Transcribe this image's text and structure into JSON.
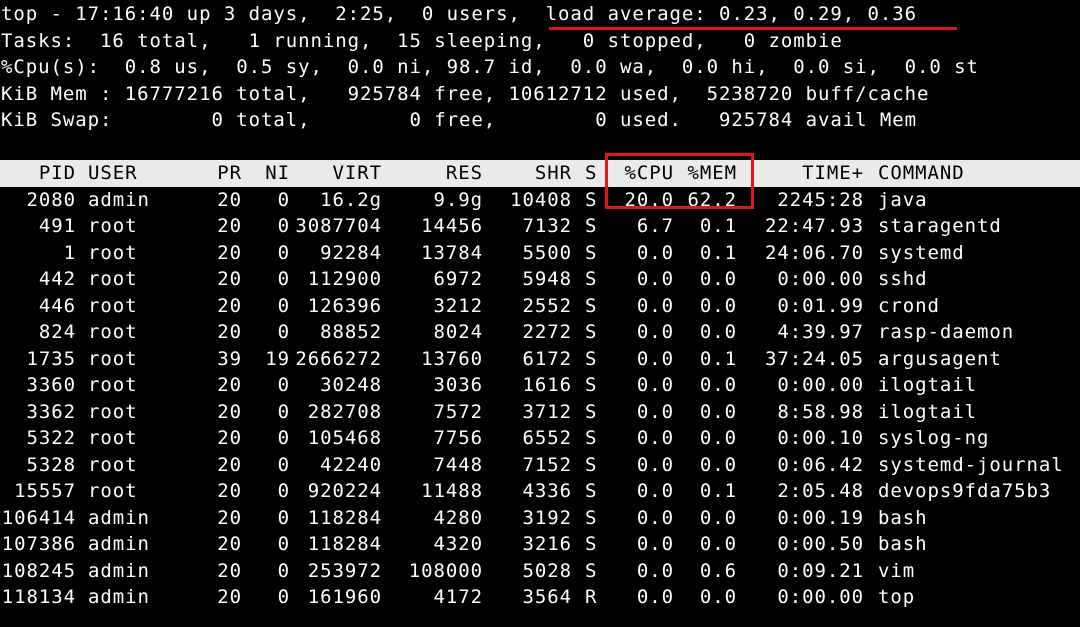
{
  "summary": [
    "top - 17:16:40 up 3 days,  2:25,  0 users,  load average: 0.23, 0.29, 0.36",
    "Tasks:  16 total,   1 running,  15 sleeping,   0 stopped,   0 zombie",
    "%Cpu(s):  0.8 us,  0.5 sy,  0.0 ni, 98.7 id,  0.0 wa,  0.0 hi,  0.0 si,  0.0 st",
    "KiB Mem : 16777216 total,   925784 free, 10612712 used,  5238720 buff/cache",
    "KiB Swap:        0 total,        0 free,        0 used.   925784 avail Mem"
  ],
  "columns": [
    "PID",
    "USER",
    "PR",
    "NI",
    "VIRT",
    "RES",
    "SHR",
    "S",
    "%CPU",
    "%MEM",
    "TIME+",
    "COMMAND"
  ],
  "processes": [
    [
      "2080",
      "admin",
      "20",
      "0",
      "16.2g",
      "9.9g",
      "10408",
      "S",
      "20.0",
      "62.2",
      "2245:28",
      "java"
    ],
    [
      "491",
      "root",
      "20",
      "0",
      "3087704",
      "14456",
      "7132",
      "S",
      "6.7",
      "0.1",
      "22:47.93",
      "staragentd"
    ],
    [
      "1",
      "root",
      "20",
      "0",
      "92284",
      "13784",
      "5500",
      "S",
      "0.0",
      "0.1",
      "24:06.70",
      "systemd"
    ],
    [
      "442",
      "root",
      "20",
      "0",
      "112900",
      "6972",
      "5948",
      "S",
      "0.0",
      "0.0",
      "0:00.00",
      "sshd"
    ],
    [
      "446",
      "root",
      "20",
      "0",
      "126396",
      "3212",
      "2552",
      "S",
      "0.0",
      "0.0",
      "0:01.99",
      "crond"
    ],
    [
      "824",
      "root",
      "20",
      "0",
      "88852",
      "8024",
      "2272",
      "S",
      "0.0",
      "0.0",
      "4:39.97",
      "rasp-daemon"
    ],
    [
      "1735",
      "root",
      "39",
      "19",
      "2666272",
      "13760",
      "6172",
      "S",
      "0.0",
      "0.1",
      "37:24.05",
      "argusagent"
    ],
    [
      "3360",
      "root",
      "20",
      "0",
      "30248",
      "3036",
      "1616",
      "S",
      "0.0",
      "0.0",
      "0:00.00",
      "ilogtail"
    ],
    [
      "3362",
      "root",
      "20",
      "0",
      "282708",
      "7572",
      "3712",
      "S",
      "0.0",
      "0.0",
      "8:58.98",
      "ilogtail"
    ],
    [
      "5322",
      "root",
      "20",
      "0",
      "105468",
      "7756",
      "6552",
      "S",
      "0.0",
      "0.0",
      "0:00.10",
      "syslog-ng"
    ],
    [
      "5328",
      "root",
      "20",
      "0",
      "42240",
      "7448",
      "7152",
      "S",
      "0.0",
      "0.0",
      "0:06.42",
      "systemd-journal"
    ],
    [
      "15557",
      "root",
      "20",
      "0",
      "920224",
      "11488",
      "4336",
      "S",
      "0.0",
      "0.1",
      "2:05.48",
      "devops9fda75b3"
    ],
    [
      "106414",
      "admin",
      "20",
      "0",
      "118284",
      "4280",
      "3192",
      "S",
      "0.0",
      "0.0",
      "0:00.19",
      "bash"
    ],
    [
      "107386",
      "admin",
      "20",
      "0",
      "118284",
      "4320",
      "3216",
      "S",
      "0.0",
      "0.0",
      "0:00.50",
      "bash"
    ],
    [
      "108245",
      "admin",
      "20",
      "0",
      "253972",
      "108000",
      "5028",
      "S",
      "0.0",
      "0.6",
      "0:09.21",
      "vim"
    ],
    [
      "118134",
      "admin",
      "20",
      "0",
      "161960",
      "4172",
      "3564",
      "R",
      "0.0",
      "0.0",
      "0:00.00",
      "top"
    ]
  ],
  "colors": {
    "background": "#000000",
    "text": "#ffffff",
    "header_bg": "#eaeaea",
    "header_text": "#000000",
    "annotation": "#e1141b"
  }
}
